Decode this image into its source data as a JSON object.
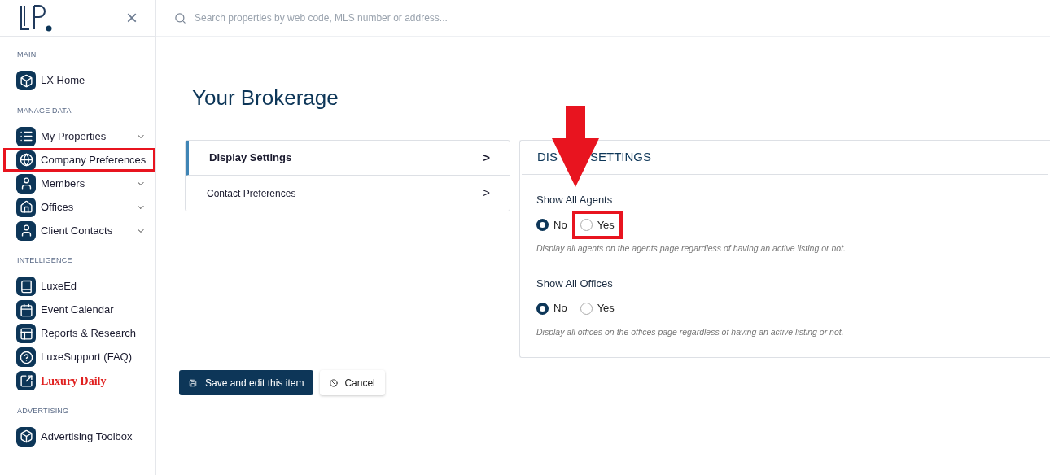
{
  "sidebar": {
    "close_label": "×",
    "sections": [
      {
        "title": "MAIN",
        "items": [
          {
            "label": "LX Home",
            "kind": "link",
            "expandable": false,
            "annotated": false
          }
        ]
      },
      {
        "title": "MANAGE DATA",
        "items": [
          {
            "label": "My Properties",
            "kind": "link",
            "expandable": true,
            "annotated": false
          },
          {
            "label": "Company Preferences",
            "kind": "link",
            "expandable": false,
            "annotated": true
          },
          {
            "label": "Members",
            "kind": "link",
            "expandable": true,
            "annotated": false
          },
          {
            "label": "Offices",
            "kind": "link",
            "expandable": true,
            "annotated": false
          },
          {
            "label": "Client Contacts",
            "kind": "link",
            "expandable": true,
            "annotated": false
          }
        ]
      },
      {
        "title": "INTELLIGENCE",
        "items": [
          {
            "label": "LuxeEd",
            "kind": "link",
            "expandable": false,
            "annotated": false
          },
          {
            "label": "Event Calendar",
            "kind": "link",
            "expandable": false,
            "annotated": false
          },
          {
            "label": "Reports & Research",
            "kind": "link",
            "expandable": false,
            "annotated": false
          },
          {
            "label": "LuxeSupport (FAQ)",
            "kind": "link",
            "expandable": false,
            "annotated": false
          },
          {
            "label": "Luxury Daily",
            "kind": "brand",
            "expandable": false,
            "annotated": false
          }
        ]
      },
      {
        "title": "ADVERTISING",
        "items": [
          {
            "label": "Advertising Toolbox",
            "kind": "link",
            "expandable": false,
            "annotated": false
          }
        ]
      }
    ]
  },
  "search": {
    "placeholder": "Search properties by web code, MLS number or address..."
  },
  "page_title": "Your Brokerage",
  "settings_nav": [
    {
      "label": "Display Settings",
      "arrow": ">",
      "selected": true
    },
    {
      "label": "Contact Preferences",
      "arrow": ">",
      "selected": false
    }
  ],
  "panel": {
    "heading_parts": [
      "DIS",
      "SETTINGS"
    ],
    "arrow_annotation": true,
    "fields": [
      {
        "label": "Show All Agents",
        "options": [
          {
            "label": "No",
            "selected": true,
            "annotated": false
          },
          {
            "label": "Yes",
            "selected": false,
            "annotated": true
          }
        ],
        "help": "Display all agents on the agents page regardless of having an active listing or not."
      },
      {
        "label": "Show All Offices",
        "options": [
          {
            "label": "No",
            "selected": true,
            "annotated": false
          },
          {
            "label": "Yes",
            "selected": false,
            "annotated": false
          }
        ],
        "help": "Display all offices on the offices page regardless of having an active listing or not."
      }
    ]
  },
  "buttons": [
    {
      "label": "Save and edit this item",
      "kind": "primary"
    },
    {
      "label": "Cancel",
      "kind": "secondary"
    }
  ]
}
